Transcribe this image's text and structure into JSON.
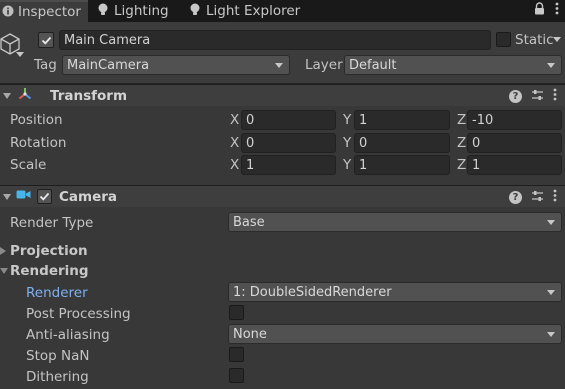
{
  "tabs": [
    {
      "label": "Inspector",
      "icon": "info-icon"
    },
    {
      "label": "Lighting",
      "icon": "bulb-icon"
    },
    {
      "label": "Light Explorer",
      "icon": "bulb-icon"
    }
  ],
  "header": {
    "object_name": "Main Camera",
    "static_label": "Static",
    "tag_label": "Tag",
    "tag_value": "MainCamera",
    "layer_label": "Layer",
    "layer_value": "Default"
  },
  "transform": {
    "title": "Transform",
    "rows": [
      {
        "label": "Position",
        "x": "0",
        "y": "1",
        "z": "-10"
      },
      {
        "label": "Rotation",
        "x": "0",
        "y": "0",
        "z": "0"
      },
      {
        "label": "Scale",
        "x": "1",
        "y": "1",
        "z": "1"
      }
    ],
    "axis_x": "X",
    "axis_y": "Y",
    "axis_z": "Z"
  },
  "camera": {
    "title": "Camera",
    "render_type_label": "Render Type",
    "render_type_value": "Base",
    "projection_label": "Projection",
    "rendering_label": "Rendering",
    "renderer_label": "Renderer",
    "renderer_value": "1: DoubleSidedRenderer",
    "post_processing_label": "Post Processing",
    "antialiasing_label": "Anti-aliasing",
    "antialiasing_value": "None",
    "stop_nan_label": "Stop NaN",
    "dithering_label": "Dithering"
  },
  "colors": {
    "background": "#383838",
    "tabbar": "#191919",
    "link": "#7fb0f0",
    "field": "#2a2a2a"
  }
}
